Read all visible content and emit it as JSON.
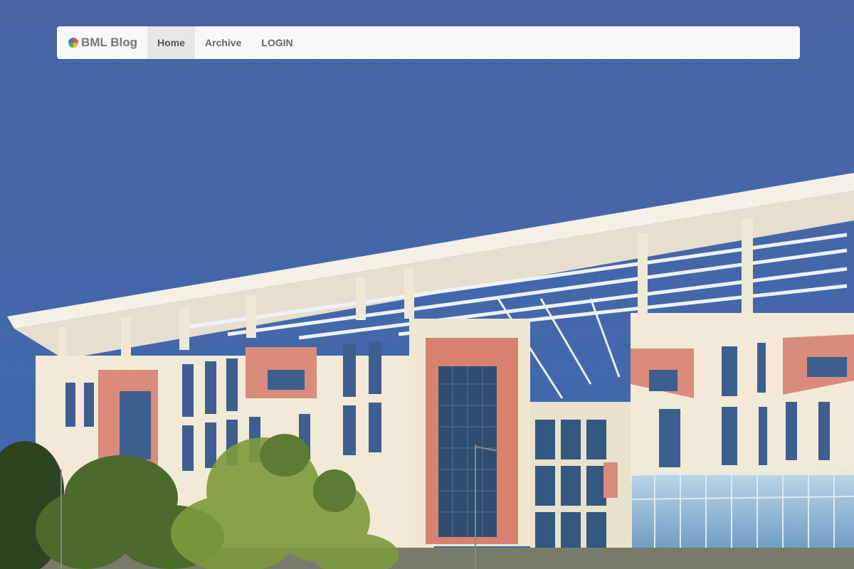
{
  "navbar": {
    "brand": "BML Blog",
    "brand_icon": "multicolor-circle-logo",
    "items": [
      {
        "label": "Home",
        "active": true
      },
      {
        "label": "Archive",
        "active": false
      },
      {
        "label": "LOGIN",
        "active": false
      }
    ]
  },
  "hero": {
    "image": "campus-building-photo",
    "colors": {
      "sky": "#4a68a6",
      "building": "#f2ead6",
      "accent_panel": "#d98b7c",
      "glass": "#5a84b4",
      "trees": "#3e5a2a"
    }
  }
}
